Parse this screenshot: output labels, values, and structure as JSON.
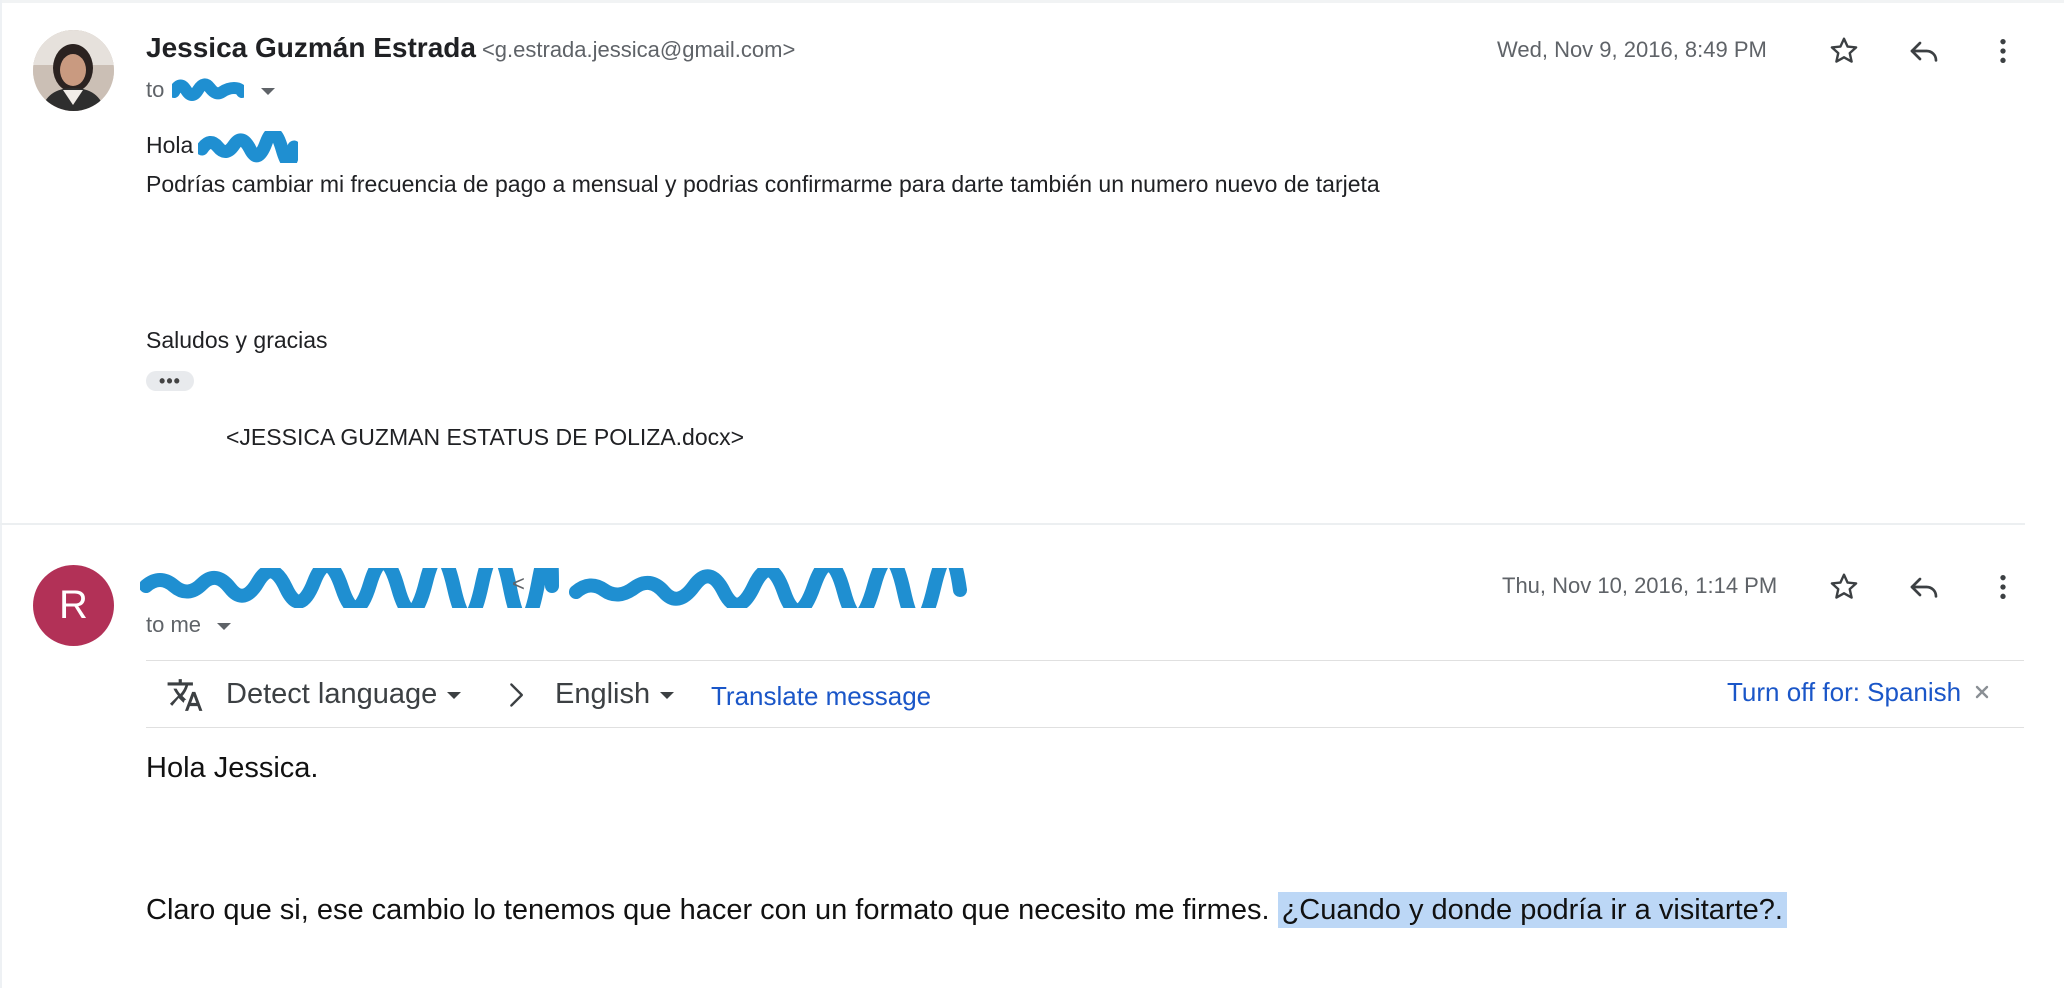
{
  "messages": [
    {
      "sender_name": "Jessica Guzmán Estrada",
      "sender_email": "<g.estrada.jessica@gmail.com>",
      "to_prefix": "to",
      "date": "Wed, Nov 9, 2016, 8:49 PM",
      "greeting": "Hola",
      "body": "Podrías cambiar mi frecuencia de pago a mensual y podrias confirmarme para darte también un numero nuevo de tarjeta",
      "signoff": "Saludos y gracias",
      "ellipsis": "•••",
      "attachment": "<JESSICA GUZMAN ESTATUS DE POLIZA.docx>"
    },
    {
      "avatar_initial": "R",
      "email_bracket": "<",
      "to_line": "to me",
      "date": "Thu, Nov 10, 2016, 1:14 PM",
      "greeting": "Hola Jessica.",
      "body_plain": "Claro que si, ese cambio lo tenemos que hacer con un formato que necesito me firmes.",
      "body_highlight": "¿Cuando y donde podría ir a visitarte?."
    }
  ],
  "translate_bar": {
    "source_language": "Detect language",
    "target_language": "English",
    "translate_link": "Translate message",
    "turn_off": "Turn off for: Spanish"
  },
  "icons": {
    "star": "star-icon",
    "reply": "reply-icon",
    "more": "more-vert-icon",
    "translate": "translate-icon",
    "chevron_right": "chevron-right-icon",
    "close": "close-icon"
  },
  "colors": {
    "avatar_r": "#b23157",
    "link": "#1a56c8",
    "highlight": "#bcd7f6",
    "redaction": "#1f8fd1"
  }
}
